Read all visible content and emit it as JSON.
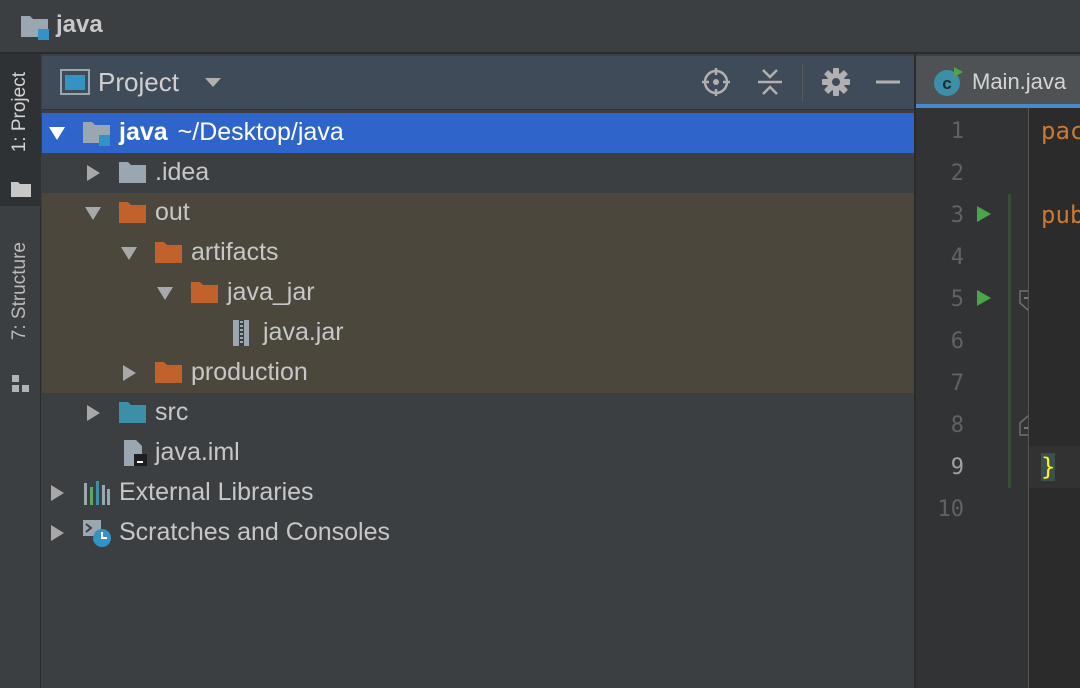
{
  "titlebar": {
    "title": "java",
    "icon": "module-folder-icon"
  },
  "tool_strip": {
    "project_label": "1: Project",
    "structure_label": "7: Structure"
  },
  "panel": {
    "title": "Project",
    "actions": [
      "locate-icon",
      "collapse-all-icon",
      "gear-icon",
      "minimize-icon"
    ]
  },
  "tree": {
    "rows": [
      {
        "name": "java",
        "path": "~/Desktop/java",
        "icon": "module-folder-icon",
        "expanded": true,
        "selected": true
      },
      {
        "name": ".idea",
        "icon": "folder-icon",
        "expanded": false
      },
      {
        "name": "out",
        "icon": "excluded-folder-icon",
        "expanded": true
      },
      {
        "name": "artifacts",
        "icon": "excluded-folder-icon",
        "expanded": true
      },
      {
        "name": "java_jar",
        "icon": "excluded-folder-icon",
        "expanded": true
      },
      {
        "name": "java.jar",
        "icon": "jar-file-icon"
      },
      {
        "name": "production",
        "icon": "excluded-folder-icon",
        "expanded": false
      },
      {
        "name": "src",
        "icon": "source-folder-icon",
        "expanded": false
      },
      {
        "name": "java.iml",
        "icon": "iml-file-icon"
      },
      {
        "name": "External Libraries",
        "icon": "libraries-icon",
        "expanded": false
      },
      {
        "name": "Scratches and Consoles",
        "icon": "scratches-icon",
        "expanded": false
      }
    ]
  },
  "editor": {
    "tab_label": "Main.java",
    "tab_icon": "java-class-icon",
    "line_numbers": [
      "1",
      "2",
      "3",
      "4",
      "5",
      "6",
      "7",
      "8",
      "9",
      "10"
    ],
    "current_line": "9",
    "code_lines": {
      "l1": "pac",
      "l3": "pub",
      "l9": "}"
    }
  },
  "colors": {
    "selection": "#2f65ca",
    "excluded_bg": "#4c473d",
    "excluded_folder": "#c1612c",
    "source_folder": "#3d8fa8",
    "run_marker": "#4aa64a",
    "keyword": "#cc7832"
  }
}
